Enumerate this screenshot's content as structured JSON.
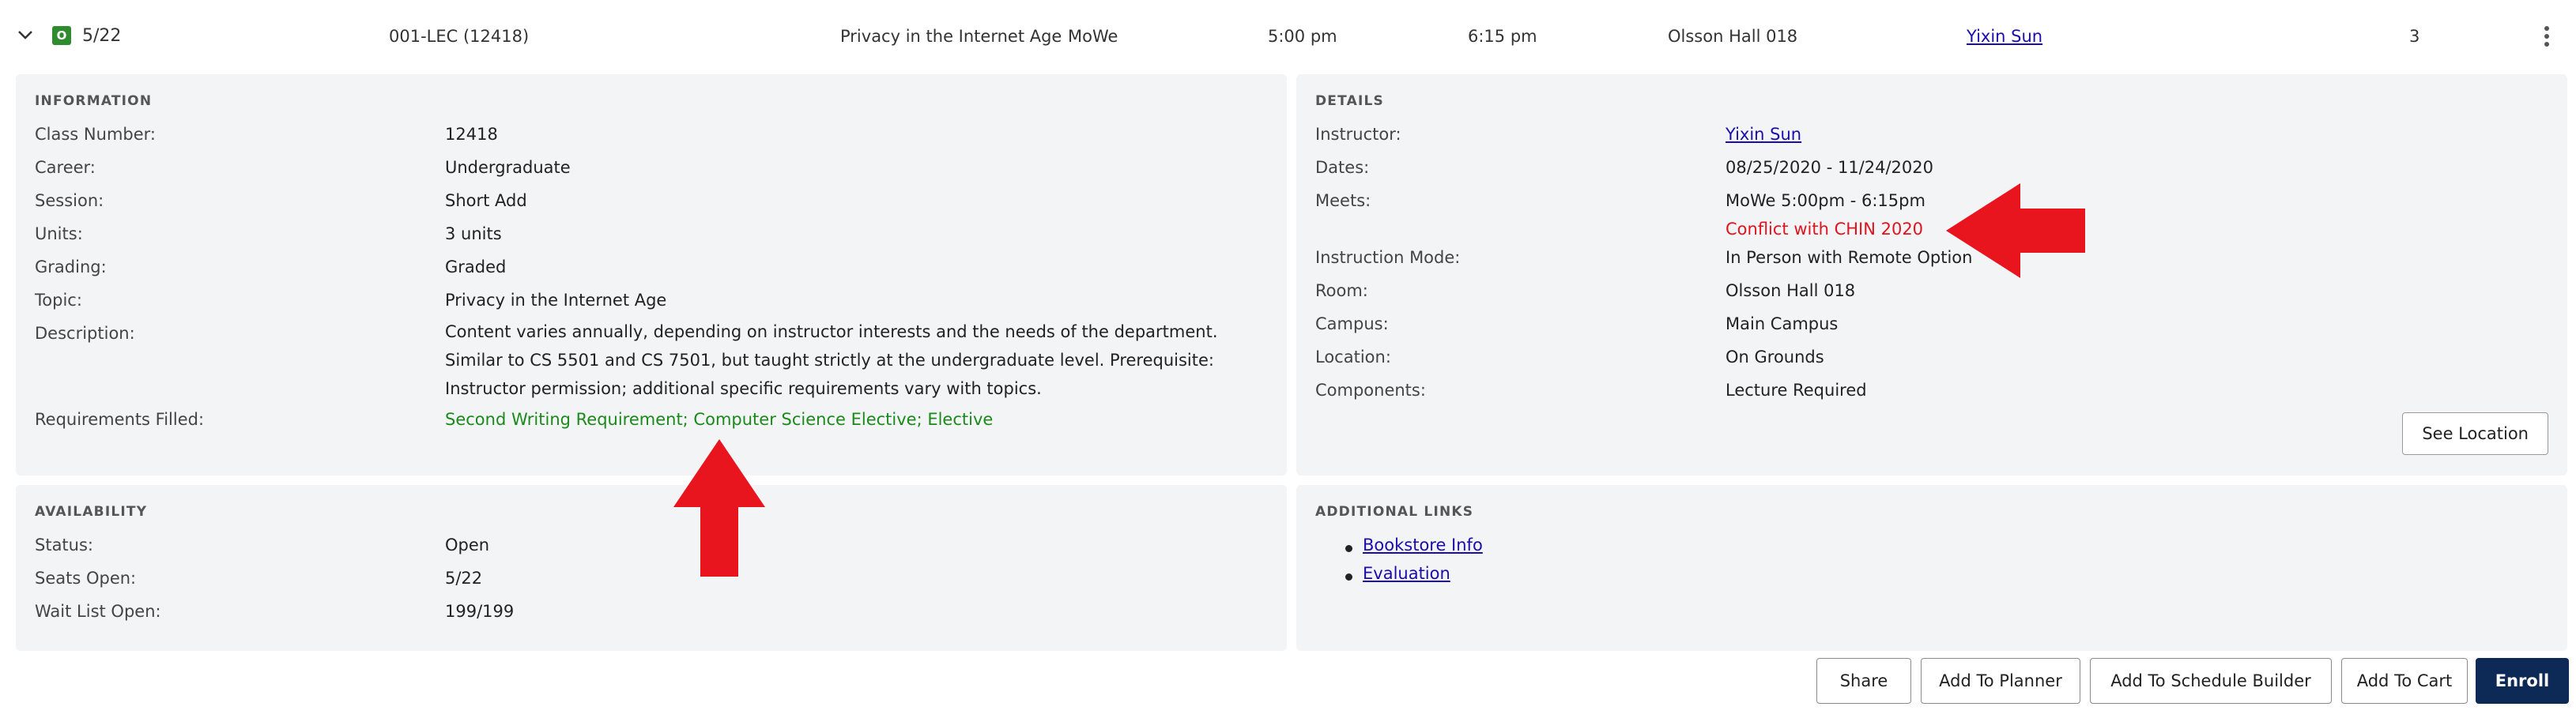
{
  "class_row": {
    "status_badge": "O",
    "seats": "5/22",
    "section": "001-LEC (12418)",
    "topic": "Privacy in the Internet Age",
    "days": "MoWe",
    "start_time": "5:00 pm",
    "end_time": "6:15 pm",
    "room": "Olsson Hall 018",
    "instructor": "Yixin Sun",
    "units": "3"
  },
  "information": {
    "title": "INFORMATION",
    "fields": [
      {
        "label": "Class Number:",
        "value": "12418"
      },
      {
        "label": "Career:",
        "value": "Undergraduate"
      },
      {
        "label": "Session:",
        "value": "Short Add"
      },
      {
        "label": "Units:",
        "value": "3 units"
      },
      {
        "label": "Grading:",
        "value": "Graded"
      },
      {
        "label": "Topic:",
        "value": "Privacy in the Internet Age"
      },
      {
        "label": "Description:",
        "value": "Content varies annually, depending on instructor interests and the needs of the department. Similar to CS 5501 and CS 7501, but taught strictly at the undergraduate level. Prerequisite: Instructor permission; additional specific requirements vary with topics."
      },
      {
        "label": "Requirements Filled:",
        "value": "Second Writing Requirement; Computer Science Elective; Elective"
      }
    ]
  },
  "details": {
    "title": "DETAILS",
    "instructor_label": "Instructor:",
    "instructor": "Yixin Sun",
    "dates_label": "Dates:",
    "dates": "08/25/2020 - 11/24/2020",
    "meets_label": "Meets:",
    "meets": "MoWe 5:00pm - 6:15pm",
    "conflict": "Conflict with CHIN 2020",
    "mode_label": "Instruction Mode:",
    "mode": "In Person with Remote Option",
    "room_label": "Room:",
    "room": "Olsson Hall 018",
    "campus_label": "Campus:",
    "campus": "Main Campus",
    "location_label": "Location:",
    "location": "On Grounds",
    "components_label": "Components:",
    "components": "Lecture Required",
    "see_location": "See Location"
  },
  "availability": {
    "title": "AVAILABILITY",
    "fields": [
      {
        "label": "Status:",
        "value": "Open"
      },
      {
        "label": "Seats Open:",
        "value": "5/22"
      },
      {
        "label": "Wait List Open:",
        "value": "199/199"
      }
    ]
  },
  "additional_links": {
    "title": "ADDITIONAL LINKS",
    "links": [
      "Bookstore Info",
      "Evaluation"
    ]
  },
  "actions": {
    "share": "Share",
    "add_to_planner": "Add To Planner",
    "add_to_schedule_builder": "Add To Schedule Builder",
    "add_to_cart": "Add To Cart",
    "enroll": "Enroll"
  },
  "colors": {
    "status_green": "#2e8b2e",
    "requirements_green": "#1a8a1a",
    "conflict_red": "#e0141e",
    "enroll_navy": "#0d2a57",
    "annotation_arrow": "#e8141e"
  },
  "icons": {
    "expand": "chevron-down-icon",
    "menu": "kebab-menu-icon",
    "annotation": "red-arrow-icon"
  }
}
